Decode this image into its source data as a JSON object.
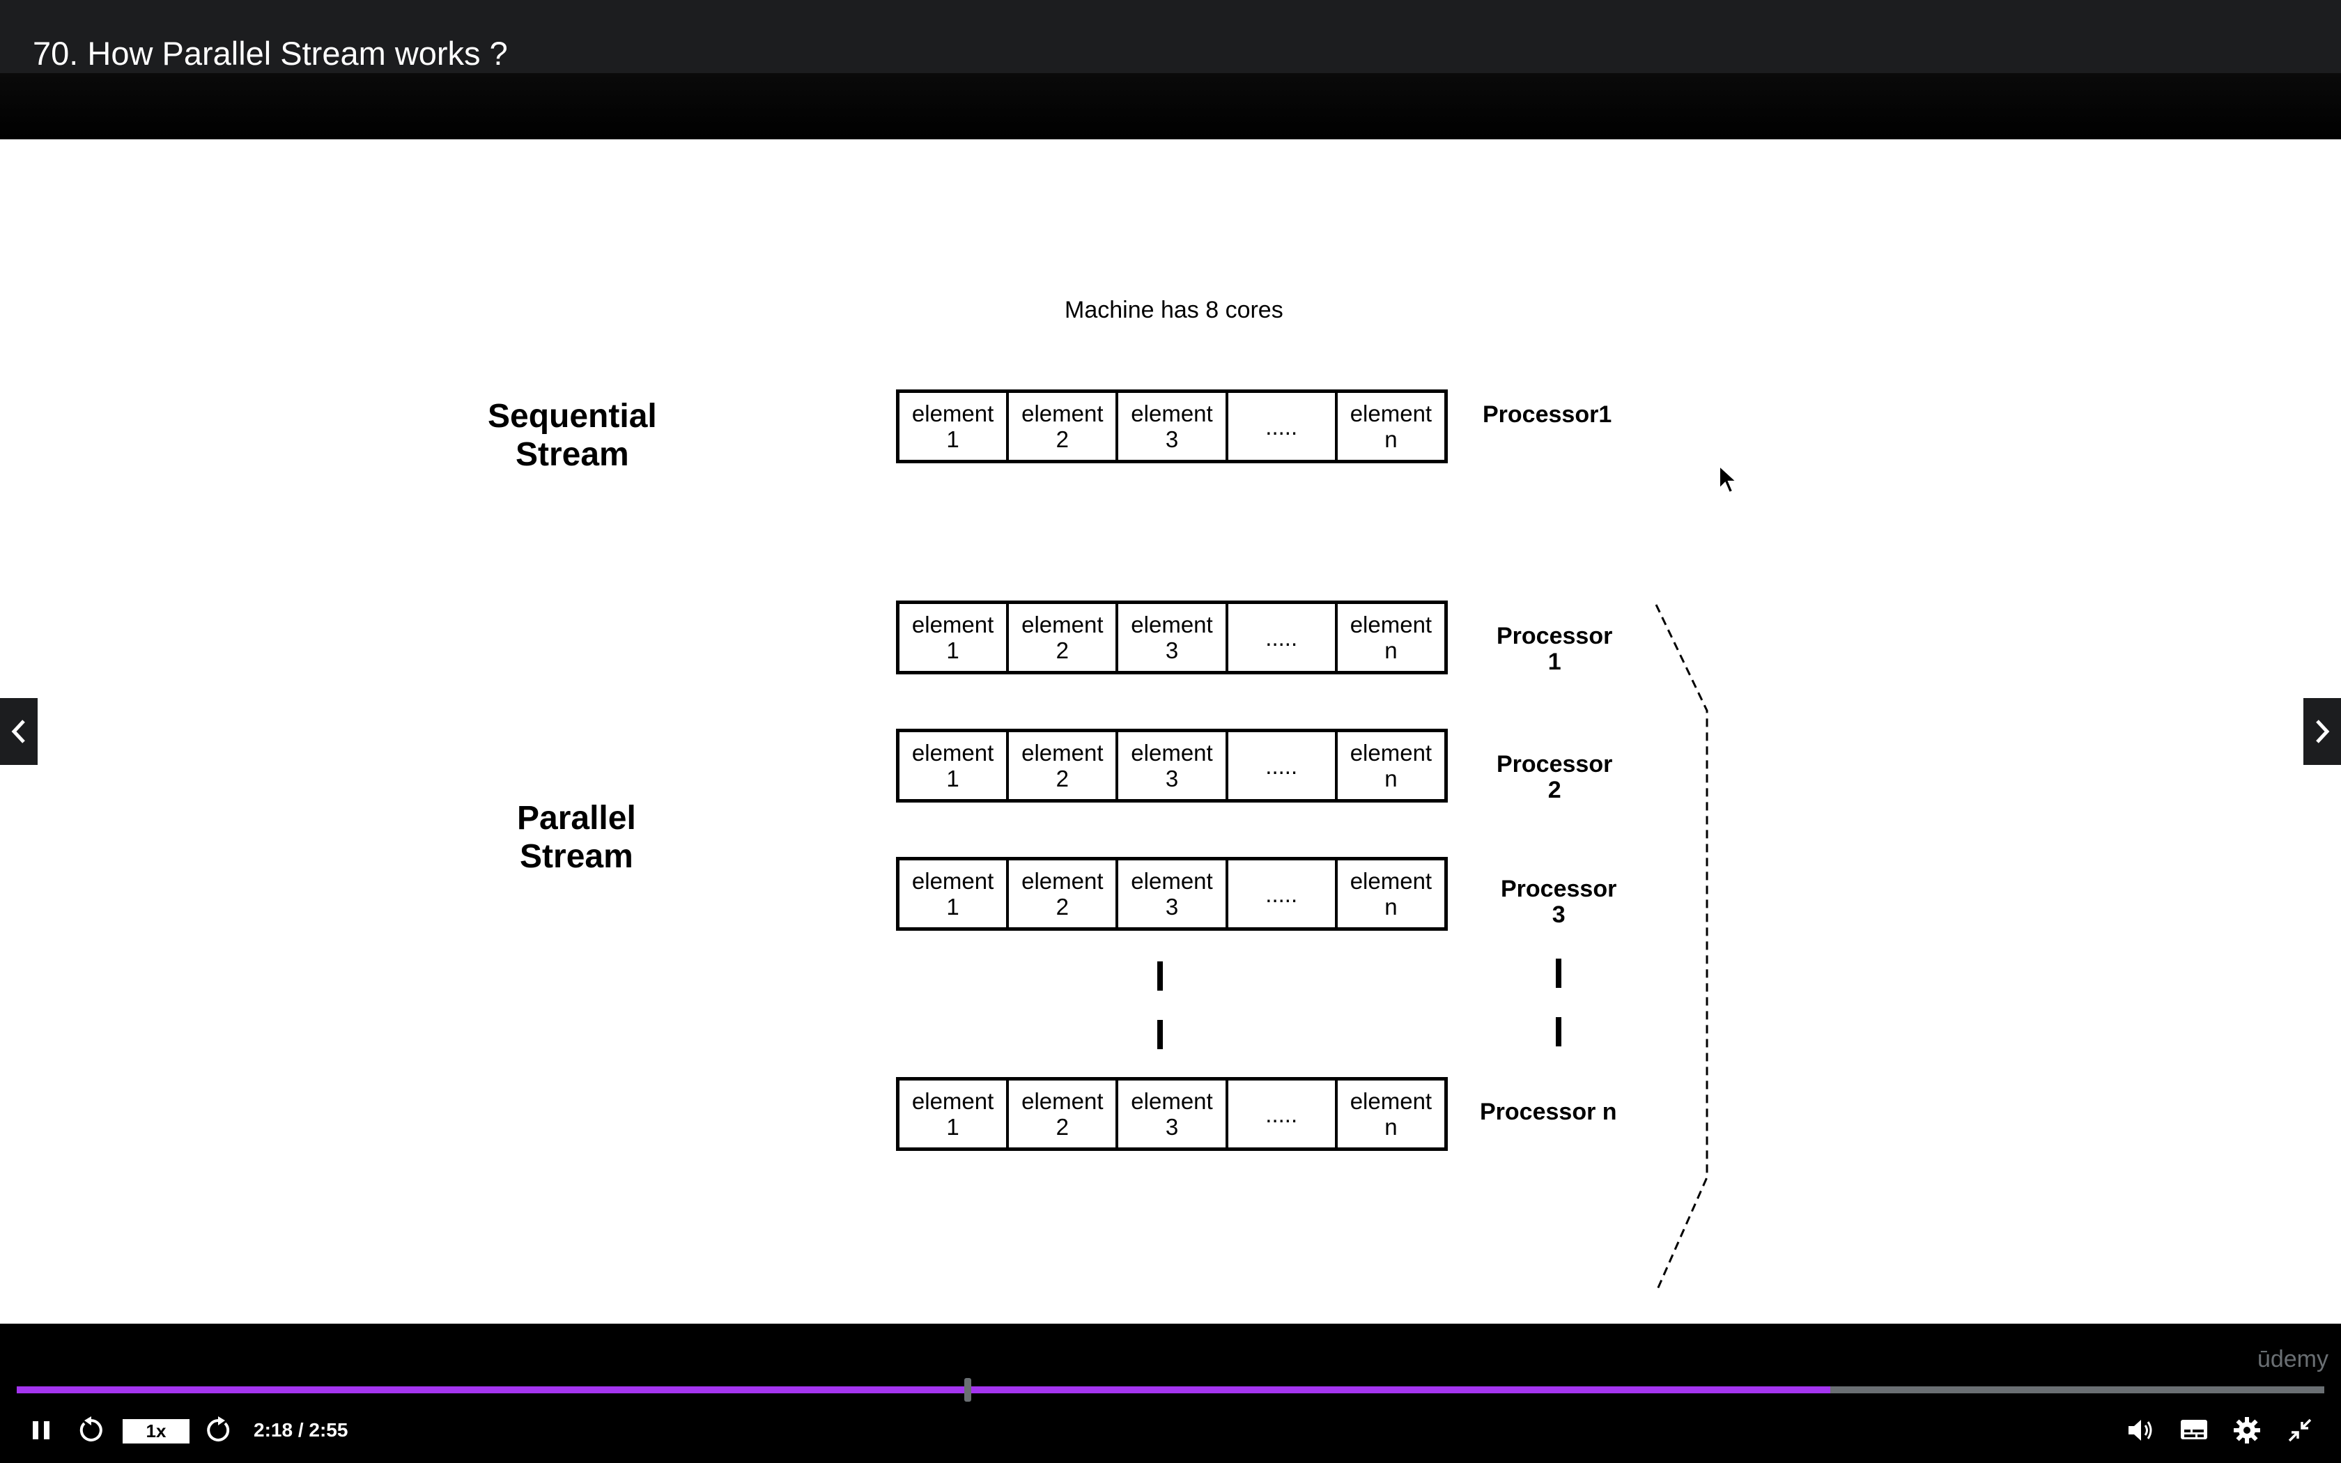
{
  "header": {
    "lecture_title": "70. How Parallel Stream works ?"
  },
  "slide": {
    "machine_note": "Machine has 8 cores",
    "sequential": {
      "label_line1": "Sequential",
      "label_line2": "Stream",
      "processor": "Processor1"
    },
    "parallel": {
      "label_line1": "Parallel",
      "label_line2": "Stream",
      "processors": [
        {
          "line1": "Processor",
          "line2": "1"
        },
        {
          "line1": "Processor",
          "line2": "2"
        },
        {
          "line1": "Processor",
          "line2": "3"
        },
        {
          "line1": "Processor n",
          "line2": ""
        }
      ]
    },
    "cells": [
      {
        "line1": "element",
        "line2": "1"
      },
      {
        "line1": "element",
        "line2": "2"
      },
      {
        "line1": "element",
        "line2": "3"
      },
      {
        "line1": ".....",
        "line2": ""
      },
      {
        "line1": "element",
        "line2": "n"
      }
    ]
  },
  "player": {
    "speed": "1x",
    "time": "2:18 / 2:55",
    "progress": 0.786,
    "brand": "ūdemy"
  },
  "icons": {
    "prev_lecture": "chevron-left-icon",
    "next_lecture": "chevron-right-icon",
    "anno_back": "arrow-left-icon",
    "anno_pen": "pencil-icon",
    "anno_notes": "notes-icon",
    "anno_forward": "arrow-right-icon",
    "play_pause": "pause-icon",
    "rewind": "rewind-icon",
    "forward": "forward-icon",
    "volume": "volume-icon",
    "captions": "captions-icon",
    "settings": "gear-icon",
    "exit_fullscreen": "exit-fullscreen-icon"
  }
}
